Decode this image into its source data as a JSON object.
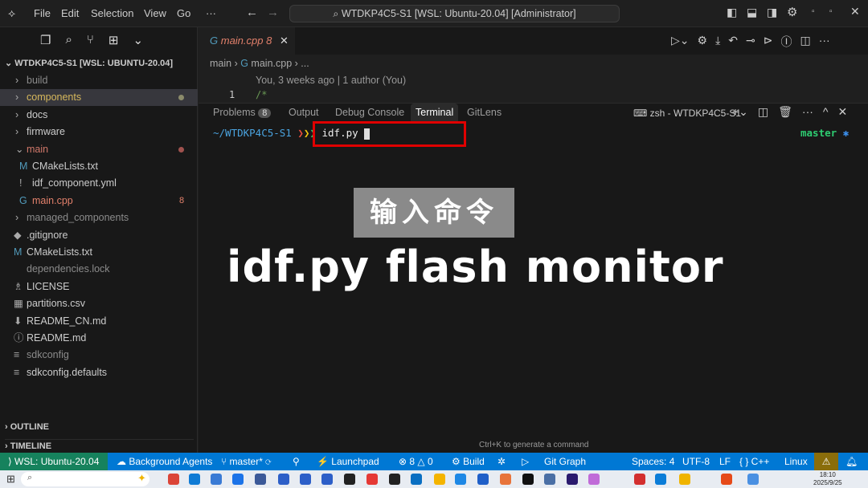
{
  "titlebar": {
    "menu": [
      "File",
      "Edit",
      "Selection",
      "View",
      "Go",
      "···"
    ],
    "command_center": "WTDKP4C5-S1 [WSL: Ubuntu-20.04] [Administrator]"
  },
  "sidebar": {
    "root": "WTDKP4C5-S1 [WSL: UBUNTU-20.04]",
    "items": [
      {
        "label": "build",
        "type": "folder",
        "color": "#8b8b8b"
      },
      {
        "label": "components",
        "type": "folder",
        "color": "#d7b85c",
        "dot": true,
        "selected": true
      },
      {
        "label": "docs",
        "type": "folder",
        "color": "#cccccc"
      },
      {
        "label": "firmware",
        "type": "folder",
        "color": "#cccccc"
      },
      {
        "label": "main",
        "type": "folder-open",
        "color": "#d1786a",
        "dot": true
      },
      {
        "label": "CMakeLists.txt",
        "icon": "M",
        "color": "#cccccc",
        "indent": true
      },
      {
        "label": "idf_component.yml",
        "icon": "!",
        "color": "#cccccc",
        "indent": true
      },
      {
        "label": "main.cpp",
        "icon": "G",
        "color": "#e2806b",
        "indent": true,
        "badge": "8"
      },
      {
        "label": "managed_components",
        "type": "folder",
        "color": "#8b8b8b"
      },
      {
        "label": ".gitignore",
        "icon": "◆",
        "color": "#cccccc"
      },
      {
        "label": "CMakeLists.txt",
        "icon": "M",
        "color": "#cccccc"
      },
      {
        "label": "dependencies.lock",
        "icon": "",
        "color": "#8b8b8b"
      },
      {
        "label": "LICENSE",
        "icon": "♗",
        "color": "#cccccc"
      },
      {
        "label": "partitions.csv",
        "icon": "▦",
        "color": "#cccccc"
      },
      {
        "label": "README_CN.md",
        "icon": "⬇",
        "color": "#cccccc"
      },
      {
        "label": "README.md",
        "icon": "ⓘ",
        "color": "#cccccc"
      },
      {
        "label": "sdkconfig",
        "icon": "≡",
        "color": "#8b8b8b"
      },
      {
        "label": "sdkconfig.defaults",
        "icon": "≡",
        "color": "#cccccc"
      }
    ],
    "outline": "OUTLINE",
    "timeline": "TIMELINE"
  },
  "editor": {
    "tab": "main.cpp",
    "tab_badge": "8",
    "breadcrumb": [
      "main",
      "main.cpp",
      "..."
    ],
    "codelens": "You, 3 weeks ago | 1 author (You)",
    "line_no": "1",
    "line_text": "/*"
  },
  "panel": {
    "tabs": [
      "Problems",
      "Output",
      "Debug Console",
      "Terminal",
      "GitLens"
    ],
    "problems_count": "8",
    "active": "Terminal",
    "terminal_name": "zsh - WTDKP4C5-S1",
    "prompt_path": "~/WTDKP4C5-S1",
    "command": "idf.py",
    "branch": "master",
    "hint": "Ctrl+K to generate a command"
  },
  "overlay": {
    "caption": "输入命令",
    "command": "idf.py flash monitor"
  },
  "statusbar": {
    "remote": "WSL: Ubuntu-20.04",
    "agents": "Background Agents",
    "branch": "master*",
    "launchpad": "Launchpad",
    "errors": "8",
    "warnings": "0",
    "build": "Build",
    "git_graph": "Git Graph",
    "spaces": "Spaces: 4",
    "encoding": "UTF-8",
    "eol": "LF",
    "language": "{ } C++",
    "os": "Linux"
  },
  "taskbar": {
    "time": "18:10",
    "date": "2025/9/25"
  }
}
